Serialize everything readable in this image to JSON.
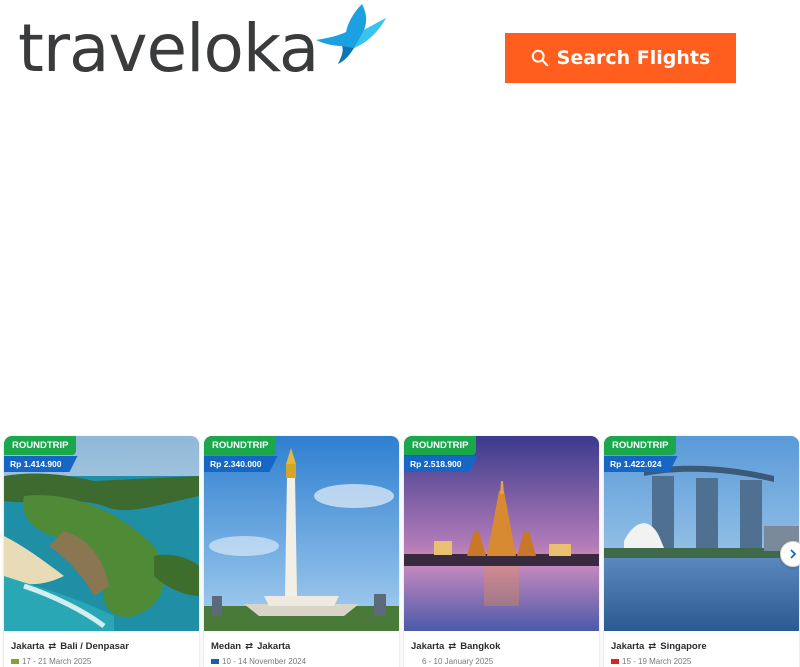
{
  "brand": {
    "name": "traveloka",
    "color": "#3a3b3d",
    "bird_color": "#1ba0e2"
  },
  "header": {
    "search_button_label": "Search Flights",
    "search_button_color": "#ff5e1f",
    "search_icon": "search-icon"
  },
  "cards": [
    {
      "trip_type": "ROUNDTRIP",
      "price": "Rp 1.414.900",
      "from": "Jakarta",
      "to": "Bali / Denpasar",
      "dates": "17 - 21 March 2025",
      "airline_color": "#7ea33b",
      "scene": "bali-coast"
    },
    {
      "trip_type": "ROUNDTRIP",
      "price": "Rp 2.340.000",
      "from": "Medan",
      "to": "Jakarta",
      "dates": "10 - 14 November 2024",
      "airline_color": "#1b5fa8",
      "scene": "monas-monument"
    },
    {
      "trip_type": "ROUNDTRIP",
      "price": "Rp 2.518.900",
      "from": "Jakarta",
      "to": "Bangkok",
      "dates": "6 - 10 January 2025",
      "airline_color": "#ffffff",
      "scene": "wat-arun-temple"
    },
    {
      "trip_type": "ROUNDTRIP",
      "price": "Rp 1.422.024",
      "from": "Jakarta",
      "to": "Singapore",
      "dates": "15 - 19 March 2025",
      "airline_color": "#d8232a",
      "scene": "marina-bay-sands"
    }
  ],
  "carousel": {
    "next_icon": "chevron-right-icon"
  },
  "colors": {
    "roundtrip_badge": "#1ba84d",
    "price_badge": "#1666c5"
  }
}
